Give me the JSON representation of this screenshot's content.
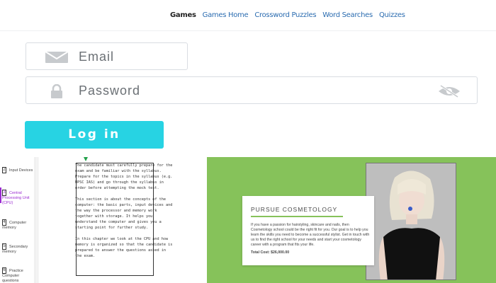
{
  "nav": {
    "items": [
      {
        "label": "Games",
        "active": true
      },
      {
        "label": "Games Home",
        "active": false
      },
      {
        "label": "Crossword Puzzles",
        "active": false
      },
      {
        "label": "Word Searches",
        "active": false
      },
      {
        "label": "Quizzes",
        "active": false
      }
    ]
  },
  "login": {
    "email_placeholder": "Email",
    "password_placeholder": "Password",
    "submit_label": "Log in",
    "accent_color": "#27d3e3",
    "icons": {
      "email": "envelope-icon",
      "password": "lock-icon",
      "toggle": "eye-slash-icon"
    }
  },
  "doc_preview": {
    "sidebar": [
      {
        "num": "2",
        "label": "Input Devices",
        "active": false
      },
      {
        "num": "3",
        "label": "Central Processing Unit (CPU)",
        "active": true
      },
      {
        "num": "4",
        "label": "Computer memory",
        "active": false
      },
      {
        "num": "5",
        "label": "Secondary memory",
        "active": false
      },
      {
        "num": "6",
        "label": "Practice Computer questions",
        "active": false
      }
    ],
    "paragraphs": [
      "The candidate must carefully prepare for the exam and be familiar with the syllabus. Prepare for the topics in the syllabus (e.g. UPSC IAS) and go through the syllabus in order before attempting the mock test.",
      "This section is about the concepts of the computer: the basic parts, input devices and the way the processor and memory work together with storage. It helps you understand the computer and gives you a starting point for further study.",
      "In this chapter we look at the CPU and how memory is organized so that the candidate is prepared to answer the questions asked in the exam."
    ]
  },
  "banner": {
    "background_color": "#86c25a",
    "title": "PURSUE COSMETOLOGY",
    "body": "If you have a passion for hairstyling, skincare and nails, then Cosmetology school could be the right fit for you. Our goal is to help you learn the skills you need to become a successful stylist. Get in touch with us to find the right school for your needs and start your cosmetology career with a program that fits your life.",
    "cost": "Total Cost: $26,000.00"
  }
}
